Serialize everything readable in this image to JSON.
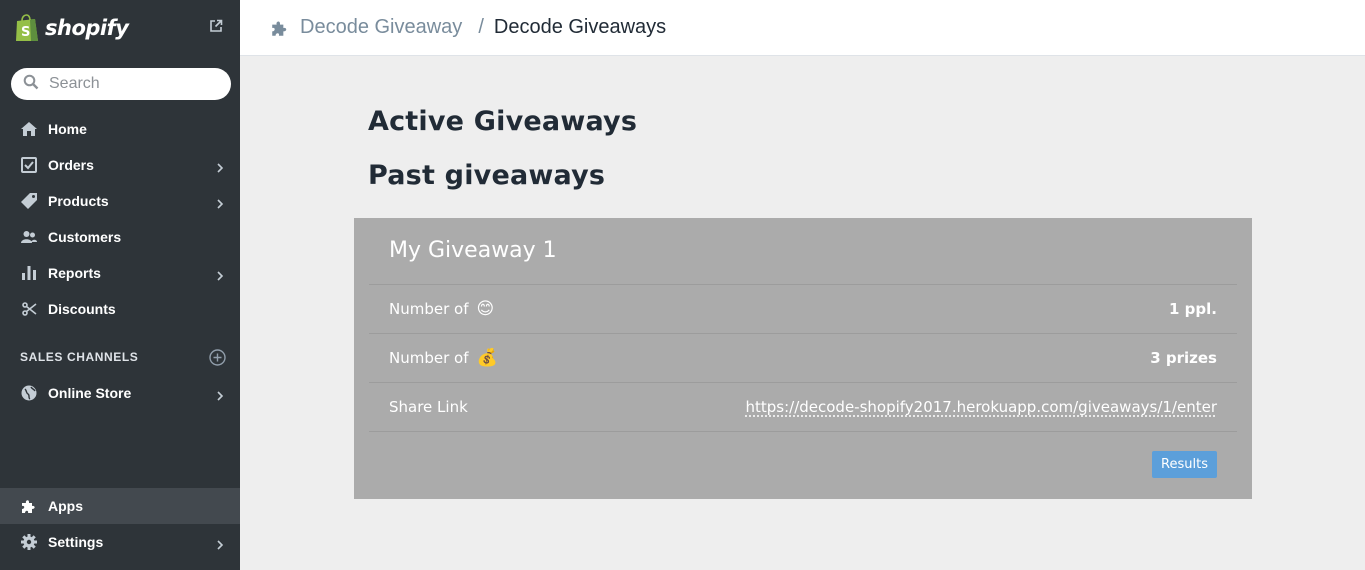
{
  "brand": {
    "name": "shopify",
    "icon": "shopify-bag-icon",
    "green": "#95bf47"
  },
  "search": {
    "placeholder": "Search",
    "value": ""
  },
  "nav": {
    "items": [
      {
        "label": "Home",
        "icon": "home-icon"
      },
      {
        "label": "Orders",
        "icon": "orders-icon"
      },
      {
        "label": "Products",
        "icon": "tag-icon"
      },
      {
        "label": "Customers",
        "icon": "customers-icon"
      },
      {
        "label": "Reports",
        "icon": "bar-chart-icon"
      },
      {
        "label": "Discounts",
        "icon": "discount-icon"
      }
    ]
  },
  "sales_channels": {
    "heading": "SALES CHANNELS",
    "store_label": "Online Store"
  },
  "bottom_nav": {
    "apps_label": "Apps",
    "settings_label": "Settings"
  },
  "breadcrumb": {
    "parent": "Decode Giveaway",
    "separator": "/",
    "current": "Decode Giveaways"
  },
  "main": {
    "active_heading": "Active Giveaways",
    "past_heading": "Past giveaways",
    "card": {
      "title": "My Giveaway 1",
      "rows": [
        {
          "label": "Number of",
          "emoji": "😊",
          "value": "1 ppl."
        },
        {
          "label": "Number of",
          "emoji": "💰",
          "value": "3 prizes"
        },
        {
          "label": "Share Link",
          "value": "https://decode-shopify2017.herokuapp.com/giveaways/1/enter"
        }
      ],
      "button_label": "Results"
    }
  },
  "colors": {
    "sidebar": "#2e3439",
    "card": "#ababab",
    "button": "#5c9fda"
  }
}
